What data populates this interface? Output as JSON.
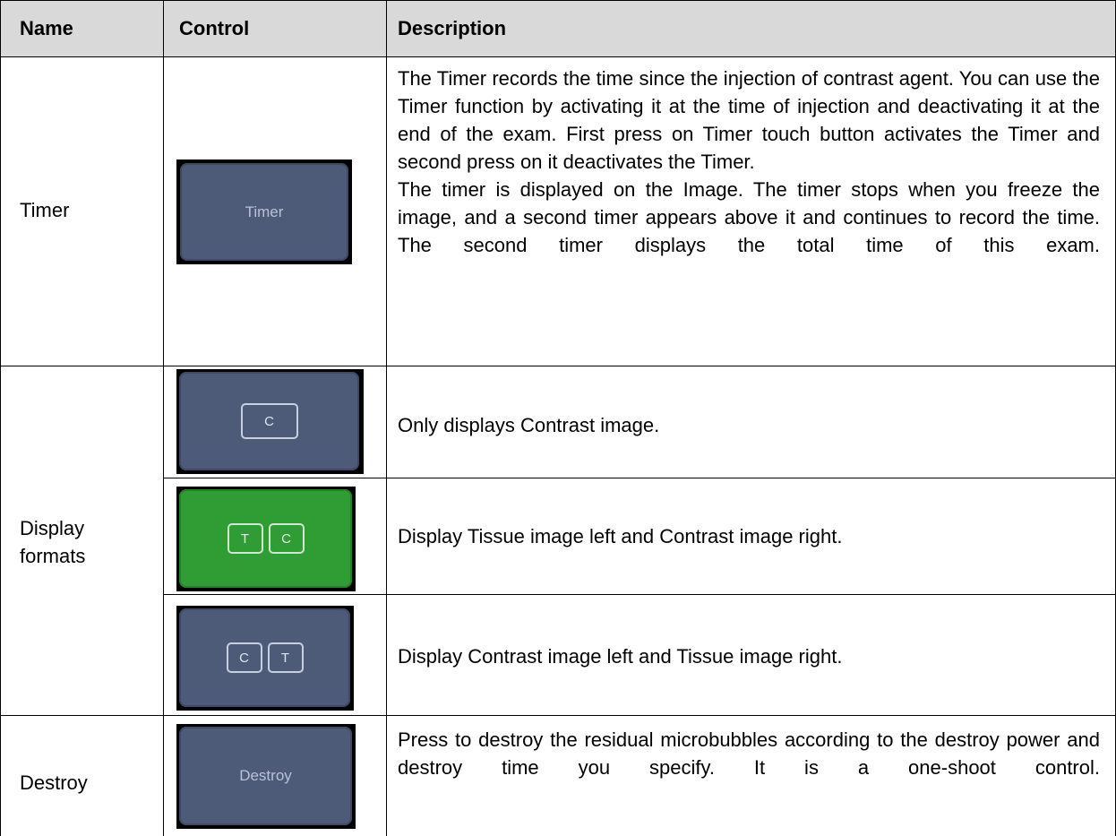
{
  "header": {
    "name": "Name",
    "control": "Control",
    "description": "Description"
  },
  "rows": [
    {
      "name": "Timer",
      "control_label": "Timer",
      "description_p1": "The Timer records the time since the injection of contrast agent. You can use the Timer function by activating it at the time of injection and deactivating it at the end of the exam. First press on Timer touch button activates the Timer and second press on it deactivates the Timer.",
      "description_p2": "The timer is displayed on the Image. The timer stops when you freeze the image, and a second timer appears above it and continues to record the time. The second timer displays the total time of this exam."
    },
    {
      "name": "Display formats",
      "sub": [
        {
          "keys": [
            "C"
          ],
          "description": "Only displays Contrast image."
        },
        {
          "keys": [
            "T",
            "C"
          ],
          "description": "Display Tissue image left and Contrast image right."
        },
        {
          "keys": [
            "C",
            "T"
          ],
          "description": "Display Contrast image left and Tissue image right."
        }
      ]
    },
    {
      "name": "Destroy",
      "control_label": "Destroy",
      "description": "Press to destroy the residual microbubbles according to the destroy power and destroy time you specify. It is a one-shoot control."
    }
  ],
  "colors": {
    "header_bg": "#d9d9d9",
    "button_blue": "#4d5a78",
    "button_green": "#2f9c34"
  }
}
